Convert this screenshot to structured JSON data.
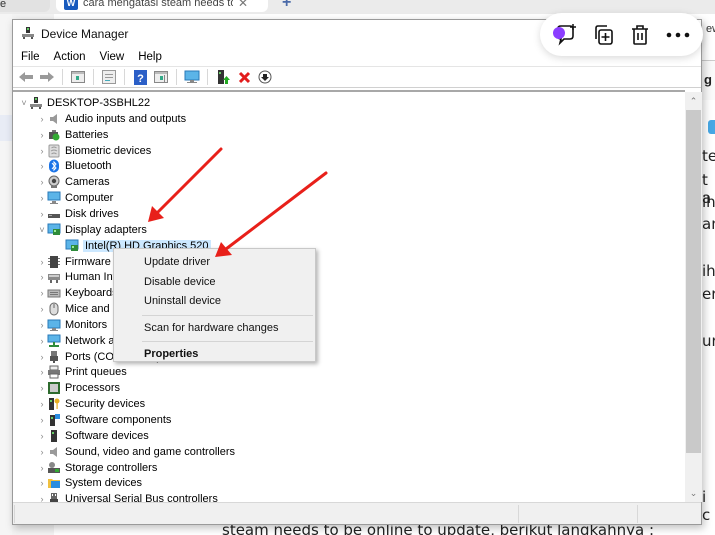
{
  "browser": {
    "left_tab_fragment": "e",
    "active_tab_title": "cara mengatasi steam needs to",
    "active_tab_icon": "W",
    "new_tab_symbol": "+",
    "right_fragment_ew": "ew",
    "right_fragment_g": "g"
  },
  "document_background": {
    "right_fragments": [
      "te",
      "t a",
      "ih",
      "an",
      "ih",
      "er",
      "ur",
      "i c"
    ],
    "bottom_text": "steam needs to be online to update, berikut langkahnya :"
  },
  "floating_toolbar": {
    "buttons": [
      {
        "name": "add-comment",
        "icon": "comment-plus-icon"
      },
      {
        "name": "duplicate",
        "icon": "copy-plus-icon"
      },
      {
        "name": "delete",
        "icon": "trash-icon"
      },
      {
        "name": "more",
        "icon": "more-horizontal-icon"
      }
    ],
    "accent_color": "#8b3dff"
  },
  "window": {
    "title": "Device Manager",
    "menu": [
      "File",
      "Action",
      "View",
      "Help"
    ],
    "toolbar": [
      {
        "name": "back",
        "icon": "arrow-left-icon"
      },
      {
        "name": "forward",
        "icon": "arrow-right-icon"
      },
      {
        "name": "show-hide-console-tree",
        "icon": "console-tree-icon"
      },
      {
        "name": "properties",
        "icon": "properties-sheet-icon"
      },
      {
        "name": "help",
        "icon": "help-icon"
      },
      {
        "name": "show-hide-action-pane",
        "icon": "action-pane-icon"
      },
      {
        "name": "scan-hardware",
        "icon": "monitor-scan-icon"
      },
      {
        "name": "update-driver",
        "icon": "update-driver-icon"
      },
      {
        "name": "uninstall-device",
        "icon": "red-x-icon"
      },
      {
        "name": "disable-device",
        "icon": "down-circle-icon"
      }
    ]
  },
  "tree": {
    "root": "DESKTOP-3SBHL22",
    "items": [
      {
        "label": "Audio inputs and outputs",
        "icon": "speaker-icon",
        "expanded": false
      },
      {
        "label": "Batteries",
        "icon": "battery-icon",
        "expanded": false
      },
      {
        "label": "Biometric devices",
        "icon": "fingerprint-icon",
        "expanded": false
      },
      {
        "label": "Bluetooth",
        "icon": "bluetooth-icon",
        "expanded": false
      },
      {
        "label": "Cameras",
        "icon": "webcam-icon",
        "expanded": false
      },
      {
        "label": "Computer",
        "icon": "computer-icon",
        "expanded": false
      },
      {
        "label": "Disk drives",
        "icon": "disk-drive-icon",
        "expanded": false
      },
      {
        "label": "Display adapters",
        "icon": "display-adapter-icon",
        "expanded": true
      },
      {
        "label": "Intel(R) HD Graphics 520",
        "icon": "display-adapter-icon",
        "child": true,
        "selected": true
      },
      {
        "label": "Firmware",
        "icon": "firmware-icon",
        "expanded": false
      },
      {
        "label": "Human Interface Devices",
        "icon": "hid-icon",
        "expanded": false
      },
      {
        "label": "Keyboards",
        "icon": "keyboard-icon",
        "expanded": false
      },
      {
        "label": "Mice and other pointing devices",
        "icon": "mouse-icon",
        "expanded": false
      },
      {
        "label": "Monitors",
        "icon": "monitor-icon",
        "expanded": false
      },
      {
        "label": "Network adapters",
        "icon": "network-icon",
        "expanded": false
      },
      {
        "label": "Ports (COM & LPT)",
        "icon": "port-icon",
        "expanded": false
      },
      {
        "label": "Print queues",
        "icon": "printer-icon",
        "expanded": false
      },
      {
        "label": "Processors",
        "icon": "processor-icon",
        "expanded": false
      },
      {
        "label": "Security devices",
        "icon": "security-key-icon",
        "expanded": false
      },
      {
        "label": "Software components",
        "icon": "software-component-icon",
        "expanded": false
      },
      {
        "label": "Software devices",
        "icon": "software-device-icon",
        "expanded": false
      },
      {
        "label": "Sound, video and game controllers",
        "icon": "speaker-icon",
        "expanded": false
      },
      {
        "label": "Storage controllers",
        "icon": "storage-controller-icon",
        "expanded": false
      },
      {
        "label": "System devices",
        "icon": "system-folder-icon",
        "expanded": false
      },
      {
        "label": "Universal Serial Bus controllers",
        "icon": "usb-icon",
        "expanded": false
      }
    ]
  },
  "context_menu": {
    "items": [
      {
        "label": "Update driver",
        "bold": false
      },
      {
        "label": "Disable device",
        "bold": false
      },
      {
        "label": "Uninstall device",
        "bold": false
      },
      {
        "separator": true
      },
      {
        "label": "Scan for hardware changes",
        "bold": false
      },
      {
        "separator": true
      },
      {
        "label": "Properties",
        "bold": true
      }
    ]
  },
  "annotations": {
    "arrow_color": "#e8201a",
    "arrow_count": 2,
    "targets": [
      "Display adapters",
      "Update driver"
    ]
  }
}
